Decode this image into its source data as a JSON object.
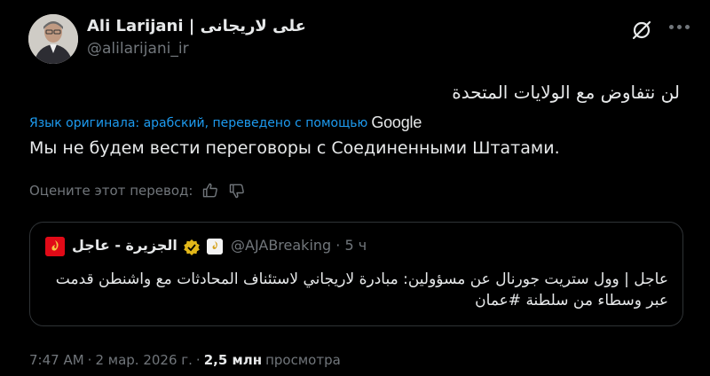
{
  "author": {
    "display_name": "Ali Larijani | علی لاریجانی",
    "handle": "@alilarijani_ir"
  },
  "icons": {
    "grok": "grok-icon",
    "more": "more-icon",
    "like": "thumbs-up-icon",
    "dislike": "thumbs-down-icon",
    "verified": "verified-gold-badge-icon",
    "affiliate": "al-jazeera-affiliate-icon"
  },
  "tweet": {
    "original_text": "لن نتفاوض مع الولايات المتحدة",
    "translated_by_label": "Язык оригинала: арабский, переведено с помощью",
    "translator_name": "Google",
    "translation": "Мы не будем вести переговоры с Соединенными Штатами.",
    "rate_label": "Оцените этот перевод:"
  },
  "quote": {
    "name": "الجزيرة - عاجل",
    "handle": "@AJABreaking",
    "separator": "·",
    "time_ago": "5 ч",
    "text": "عاجل | وول ستريت جورنال عن مسؤولين: مبادرة لاريجاني لاستئناف المحادثات مع واشنطن قدمت عبر وسطاء من سلطنة #عمان"
  },
  "footer": {
    "time": "7:47 AM",
    "dot": "·",
    "date": "2 мар. 2026 г.",
    "dot2": "·",
    "views": "2,5 млн",
    "views_label": "просмотра"
  },
  "colors": {
    "background": "#000000",
    "text": "#e7e9ea",
    "muted": "#71767b",
    "link": "#1d9bf0",
    "border": "#2f3336",
    "aj_red": "#e10a17",
    "gold": "#e2b719"
  }
}
